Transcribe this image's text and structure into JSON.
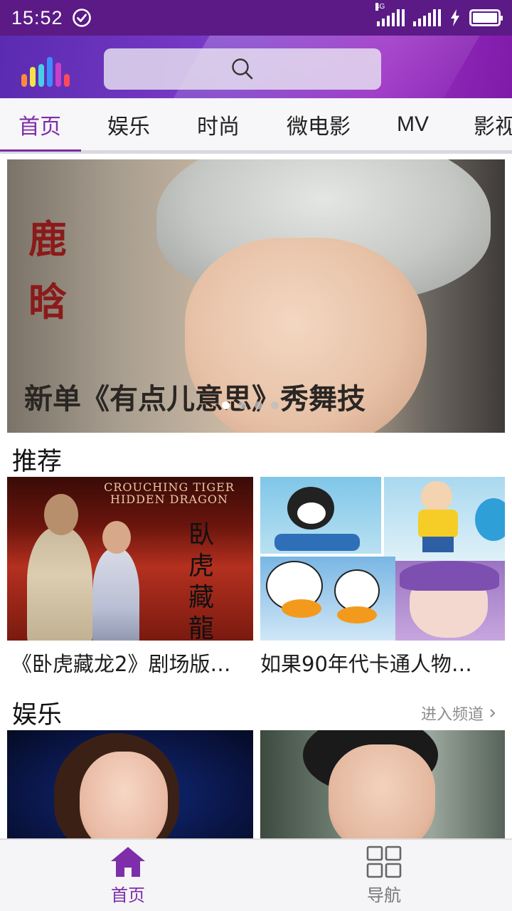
{
  "status_bar": {
    "time": "15:52",
    "network_label": "4G",
    "icons": [
      "check-circle-icon",
      "signal-4g-icon",
      "signal-icon",
      "charging-icon",
      "battery-icon"
    ],
    "battery_level": 1.0
  },
  "header": {
    "logo_icon": "equalizer-bars-icon",
    "search_icon": "search-icon",
    "search": {
      "placeholder": "",
      "value": ""
    }
  },
  "tabs": {
    "items": [
      "首页",
      "娱乐",
      "时尚",
      "微电影",
      "MV",
      "影视"
    ],
    "active": "首页"
  },
  "banner": {
    "vertical_title": "鹿晗",
    "caption": "新单《有点儿意思》秀舞技",
    "slide_count": 4,
    "active_slide": 1
  },
  "recommend": {
    "title": "推荐",
    "items": [
      {
        "caption": "《卧虎藏龙2》剧场版…",
        "poster_title_en": "CROUCHING TIGER HIDDEN DRAGON",
        "poster_title_cn": "臥虎藏龍"
      },
      {
        "caption": "如果90年代卡通人物…"
      }
    ]
  },
  "entertainment": {
    "title": "娱乐",
    "more_label": "进入频道",
    "more_icon": "chevron-right-icon"
  },
  "bottom_nav": {
    "items": [
      {
        "label": "首页",
        "icon": "home-icon",
        "active": true
      },
      {
        "label": "导航",
        "icon": "grid-icon",
        "active": false
      }
    ]
  },
  "colors": {
    "status_bar": "#5b1a86",
    "header_start": "#5a2bb0",
    "header_end": "#9a2fc4",
    "accent": "#7d2ea8",
    "tab_bar": "#f7f6f8"
  }
}
